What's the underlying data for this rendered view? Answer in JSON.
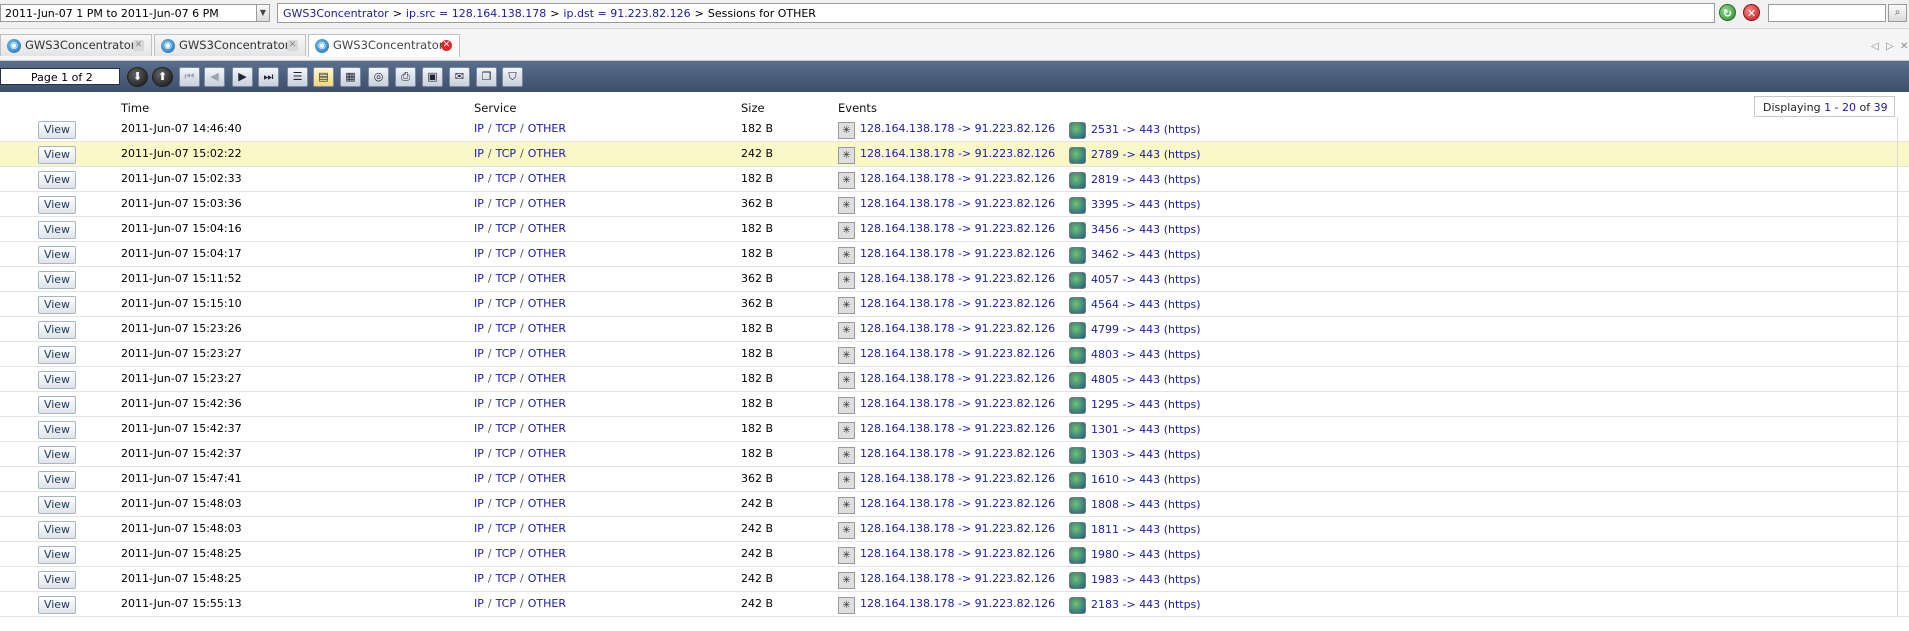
{
  "topbar": {
    "date_range": "2011-Jun-07 1 PM  to  2011-Jun-07 6 PM",
    "breadcrumb": [
      {
        "label": "GWS3Concentrator",
        "link": true
      },
      {
        "label": "ip.src = 128.164.138.178",
        "link": true
      },
      {
        "label": "ip.dst = 91.223.82.126",
        "link": true
      },
      {
        "label": "Sessions for OTHER",
        "link": false
      }
    ],
    "breadcrumb_sep": ">",
    "search_value": ""
  },
  "tabs": [
    {
      "label": "GWS3Concentrator",
      "active": false
    },
    {
      "label": "GWS3Concentrator",
      "active": false
    },
    {
      "label": "GWS3Concentrator",
      "active": true
    }
  ],
  "toolbar": {
    "page_label": "Page 1 of 2"
  },
  "grid": {
    "headers": {
      "time": "Time",
      "service": "Service",
      "size": "Size",
      "events": "Events"
    },
    "displaying": {
      "prefix": "Displaying",
      "from": "1",
      "dash": " - ",
      "to": "20",
      "of_label": "of",
      "total": "39"
    },
    "view_label": "View",
    "service_parts": [
      "IP",
      "TCP",
      "OTHER"
    ],
    "service_sep": "/",
    "arrow": "->",
    "src_ip": "128.164.138.178",
    "dst_ip": "91.223.82.126",
    "dst_port": "443",
    "dst_proto": "(https)",
    "rows": [
      {
        "time": "2011-Jun-07 14:46:40",
        "size": "182 B",
        "src_port": "2531"
      },
      {
        "time": "2011-Jun-07 15:02:22",
        "size": "242 B",
        "src_port": "2789",
        "selected": true
      },
      {
        "time": "2011-Jun-07 15:02:33",
        "size": "182 B",
        "src_port": "2819"
      },
      {
        "time": "2011-Jun-07 15:03:36",
        "size": "362 B",
        "src_port": "3395"
      },
      {
        "time": "2011-Jun-07 15:04:16",
        "size": "182 B",
        "src_port": "3456"
      },
      {
        "time": "2011-Jun-07 15:04:17",
        "size": "182 B",
        "src_port": "3462"
      },
      {
        "time": "2011-Jun-07 15:11:52",
        "size": "362 B",
        "src_port": "4057"
      },
      {
        "time": "2011-Jun-07 15:15:10",
        "size": "362 B",
        "src_port": "4564"
      },
      {
        "time": "2011-Jun-07 15:23:26",
        "size": "182 B",
        "src_port": "4799"
      },
      {
        "time": "2011-Jun-07 15:23:27",
        "size": "182 B",
        "src_port": "4803"
      },
      {
        "time": "2011-Jun-07 15:23:27",
        "size": "182 B",
        "src_port": "4805"
      },
      {
        "time": "2011-Jun-07 15:42:36",
        "size": "182 B",
        "src_port": "1295"
      },
      {
        "time": "2011-Jun-07 15:42:37",
        "size": "182 B",
        "src_port": "1301"
      },
      {
        "time": "2011-Jun-07 15:42:37",
        "size": "182 B",
        "src_port": "1303"
      },
      {
        "time": "2011-Jun-07 15:47:41",
        "size": "362 B",
        "src_port": "1610"
      },
      {
        "time": "2011-Jun-07 15:48:03",
        "size": "242 B",
        "src_port": "1808"
      },
      {
        "time": "2011-Jun-07 15:48:03",
        "size": "242 B",
        "src_port": "1811"
      },
      {
        "time": "2011-Jun-07 15:48:25",
        "size": "242 B",
        "src_port": "1980"
      },
      {
        "time": "2011-Jun-07 15:48:25",
        "size": "242 B",
        "src_port": "1983"
      },
      {
        "time": "2011-Jun-07 15:55:13",
        "size": "242 B",
        "src_port": "2183"
      }
    ]
  }
}
